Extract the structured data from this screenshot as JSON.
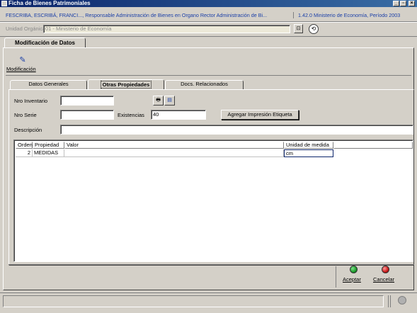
{
  "window": {
    "title": "Ficha de Bienes Patrimoniales",
    "info_left": "FESCRIBA, ESCRIBÁ, FRANCI..., Responsable Administración de Bienes en Organo Rector Administración de Bi...",
    "info_right": "1.42.0 Ministerio de Economía, Período 2003",
    "minimize": "_",
    "restore": "▫",
    "close": "×"
  },
  "unidad": {
    "label": "Unidad Orgánica:",
    "value": "01 - Ministerio de Economía"
  },
  "main_tab": "Modificación de Datos",
  "toolbar": {
    "modificacion_label": "Modificación"
  },
  "tabs": [
    {
      "label": "Datos Generales",
      "active": false
    },
    {
      "label": "Otras Propiedades",
      "active": true
    },
    {
      "label": "Docs. Relacionados",
      "active": false
    }
  ],
  "form": {
    "nro_inventario_label": "Nro Inventario",
    "nro_inventario_value": "",
    "nro_serie_label": "Nro Serie",
    "nro_serie_value": "",
    "existencias_label": "Existencias",
    "existencias_value": "40",
    "agregar_button": "Agregar Impresión Etiqueta",
    "descripcion_label": "Descripción",
    "descripcion_value": ""
  },
  "grid": {
    "columns": [
      "Orden",
      "Propiedad",
      "Valor",
      "Unidad de medida"
    ],
    "rows": [
      {
        "orden": "2",
        "propiedad": "MEDIDAS",
        "valor": "",
        "unidad": "cm"
      }
    ]
  },
  "actions": {
    "aceptar": "Aceptar",
    "cancelar": "Cancelar",
    "aceptar_color": "#1a9a2a",
    "cancelar_color": "#c81818"
  }
}
